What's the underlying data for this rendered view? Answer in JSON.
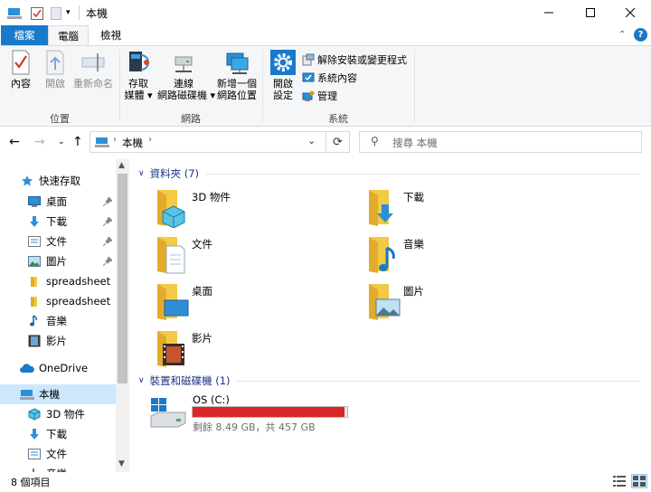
{
  "window": {
    "title": "本機"
  },
  "ribbon": {
    "tabs": [
      "檔案",
      "電腦",
      "檢視"
    ],
    "groups": {
      "location": {
        "label": "位置",
        "buttons": [
          "內容",
          "開啟",
          "重新命名"
        ]
      },
      "network": {
        "label": "網路",
        "media_line1": "存取",
        "media_line2": "媒體",
        "map_line1": "連線",
        "map_line2": "網路磁碟機",
        "add_line1": "新增一個",
        "add_line2": "網路位置"
      },
      "system": {
        "label": "系統",
        "settings_line1": "開啟",
        "settings_line2": "設定",
        "uninstall": "解除安裝或變更程式",
        "properties": "系統內容",
        "manage": "管理"
      }
    }
  },
  "address": {
    "crumb": "本機",
    "search_placeholder": "搜尋 本機"
  },
  "sidebar": {
    "quick_access": "快速存取",
    "items": [
      {
        "label": "桌面",
        "icon": "desktop-icon",
        "pinned": true
      },
      {
        "label": "下載",
        "icon": "download-icon",
        "pinned": true
      },
      {
        "label": "文件",
        "icon": "document-icon",
        "pinned": true
      },
      {
        "label": "圖片",
        "icon": "picture-icon",
        "pinned": true
      },
      {
        "label": "spreadsheet",
        "icon": "folder-icon",
        "pinned": false
      },
      {
        "label": "spreadsheet",
        "icon": "folder-icon",
        "pinned": false
      },
      {
        "label": "音樂",
        "icon": "music-icon",
        "pinned": false
      },
      {
        "label": "影片",
        "icon": "video-icon",
        "pinned": false
      }
    ],
    "onedrive": "OneDrive",
    "this_pc": "本機",
    "pc_items": [
      "3D 物件",
      "下載",
      "文件",
      "音樂"
    ]
  },
  "content": {
    "folders_header": "資料夾 (7)",
    "folders": [
      "3D 物件",
      "下載",
      "文件",
      "音樂",
      "桌面",
      "圖片",
      "影片"
    ],
    "devices_header": "裝置和磁碟機 (1)",
    "drive": {
      "name": "OS (C:)",
      "free_text": "剩餘 8.49 GB，共 457 GB",
      "used_fraction": 0.98,
      "bar_color": "#da2626"
    }
  },
  "status": {
    "items": "8 個項目"
  },
  "colors": {
    "accent": "#1979ca",
    "header_text": "#1e3287",
    "selected": "#cce8ff"
  }
}
